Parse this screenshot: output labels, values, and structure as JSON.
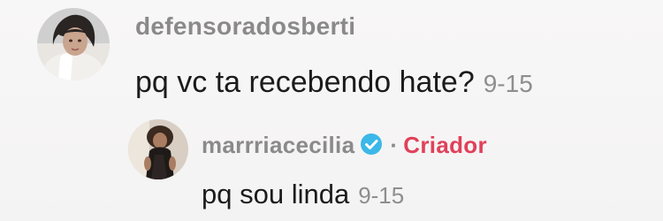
{
  "comments": [
    {
      "username": "defensoradosberti",
      "text": "pq vc ta recebendo hate?",
      "timestamp": "9-15"
    }
  ],
  "reply": {
    "username": "marrriacecilia",
    "verified_icon": "verified-badge-icon",
    "separator": "·",
    "role_badge": "Criador",
    "text": "pq sou linda",
    "timestamp": "9-15"
  },
  "colors": {
    "username": "#8a8a8a",
    "body_text": "#1b1b1b",
    "timestamp": "#8e8e8e",
    "creator_badge": "#e0405a",
    "verified": "#3bb7e8"
  }
}
